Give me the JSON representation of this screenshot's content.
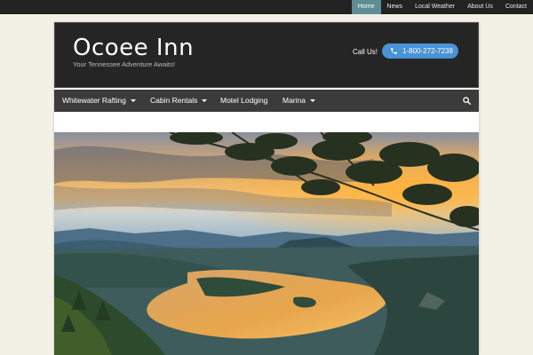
{
  "topnav": {
    "items": [
      {
        "label": "Home",
        "active": true
      },
      {
        "label": "News",
        "active": false
      },
      {
        "label": "Local Weather",
        "active": false
      },
      {
        "label": "About Us",
        "active": false
      },
      {
        "label": "Contact",
        "active": false
      }
    ]
  },
  "header": {
    "title": "Ocoee Inn",
    "tagline": "Your Tennessee Adventure Awaits!",
    "call_label": "Call Us!",
    "phone": "1-800-272-7238",
    "phone_icon": "phone-icon"
  },
  "mainnav": {
    "items": [
      {
        "label": "Whitewater Rafting",
        "has_dropdown": true
      },
      {
        "label": "Cabin Rentals",
        "has_dropdown": true
      },
      {
        "label": "Motel Lodging",
        "has_dropdown": false
      },
      {
        "label": "Marina",
        "has_dropdown": true
      }
    ],
    "search_icon": "search-icon"
  },
  "colors": {
    "page_bg": "#f3f1e5",
    "topbar_bg": "#222222",
    "active_tab": "#5f8d96",
    "header_bg": "#252525",
    "nav_bg": "#3b3b3b",
    "phone_button": "#4a93d6"
  },
  "hero": {
    "image": "sunset-lake-mountains"
  }
}
